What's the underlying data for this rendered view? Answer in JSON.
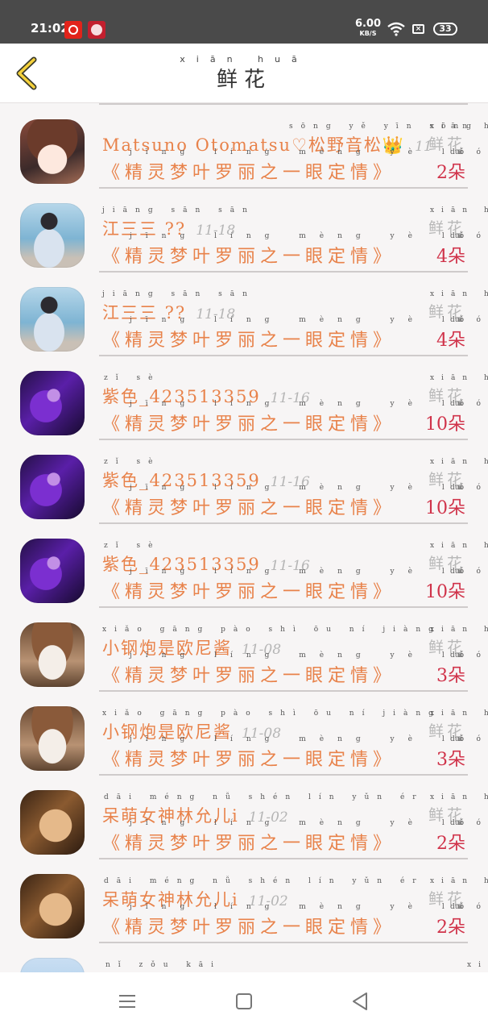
{
  "status_bar": {
    "time": "21:02",
    "speed_value": "6.00",
    "speed_unit": "KB/S",
    "battery": "33"
  },
  "header": {
    "title": "鲜花",
    "title_pinyin": "xiān huā",
    "back_icon": "chevron-left-icon"
  },
  "flower_label": "鲜花",
  "flower_label_pinyin": "xiān huā",
  "count_pinyin": "duǒ",
  "gift_text": "《精灵梦叶罗丽之一眼定情》",
  "gift_pinyin": "jīng líng mèng yè luó lì zhī yī yǎn dìng qíng",
  "rows": [
    {
      "avatar": "anime-avatar",
      "name": "Matsuno Otomatsu♡松野音松👑",
      "name_pinyin": "sōng yě yīn sōng",
      "date": "11-",
      "count": "2朵"
    },
    {
      "avatar": "girl-avatar",
      "name": "江三三 ??",
      "name_pinyin": "jiāng sān sān",
      "date": "11-18",
      "count": "4朵"
    },
    {
      "avatar": "girl-avatar",
      "name": "江三三 ??",
      "name_pinyin": "jiāng sān sān",
      "date": "11-18",
      "count": "4朵"
    },
    {
      "avatar": "purple-avatar",
      "name": "紫色_423513359",
      "name_pinyin": "zǐ sè",
      "date": "11-16",
      "count": "10朵"
    },
    {
      "avatar": "purple-avatar",
      "name": "紫色_423513359",
      "name_pinyin": "zǐ sè",
      "date": "11-16",
      "count": "10朵"
    },
    {
      "avatar": "purple-avatar",
      "name": "紫色_423513359",
      "name_pinyin": "zǐ sè",
      "date": "11-16",
      "count": "10朵"
    },
    {
      "avatar": "doll-avatar",
      "name": "小钢炮是欧尼酱",
      "name_pinyin": "xiǎo gāng pào shì ōu ní jiàng",
      "date": "11-08",
      "count": "3朵"
    },
    {
      "avatar": "doll-avatar",
      "name": "小钢炮是欧尼酱",
      "name_pinyin": "xiǎo gāng pào shì ōu ní jiàng",
      "date": "11-08",
      "count": "3朵"
    },
    {
      "avatar": "sleep-avatar",
      "name": "呆萌女神林允儿i",
      "name_pinyin": "dāi méng nǚ shén lín yǔn ér",
      "date": "11-02",
      "count": "2朵"
    },
    {
      "avatar": "sleep-avatar",
      "name": "呆萌女神林允儿i",
      "name_pinyin": "dāi méng nǚ shén lín yǔn ér",
      "date": "11-02",
      "count": "2朵"
    },
    {
      "avatar": "blue-avatar",
      "name": "",
      "name_pinyin": "nǐ zǒu kāi",
      "date": "",
      "count": ""
    }
  ],
  "nav": {
    "menu_icon": "menu-icon",
    "home_icon": "home-icon",
    "back_icon": "back-triangle-icon"
  }
}
